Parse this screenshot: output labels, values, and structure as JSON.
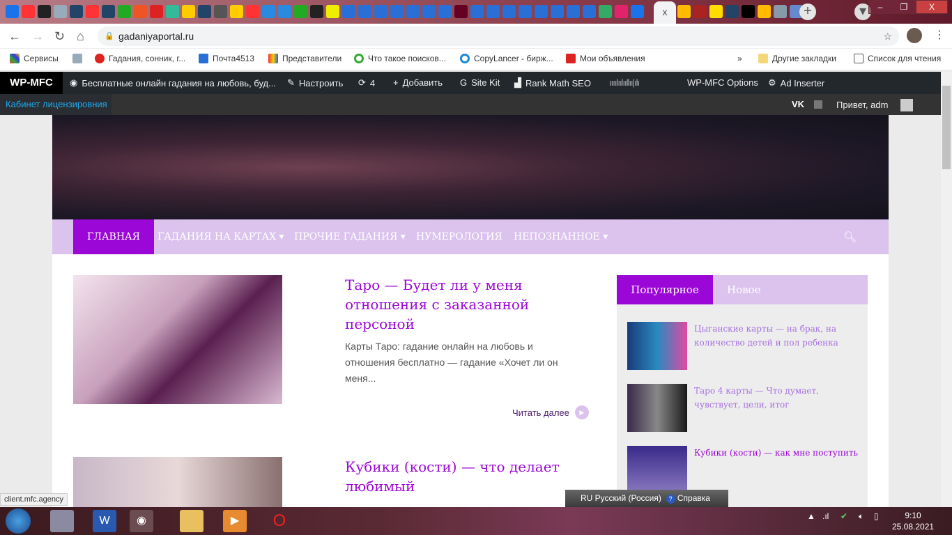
{
  "browser": {
    "url": "gadaniyaportal.ru",
    "active_tab_close": "x",
    "new_tab": "+",
    "bookmarks": [
      "Сервисы",
      "Гадания, сонник, г...",
      "Почта4513",
      "Представители",
      "Что такое поисков...",
      "CopyLancer - бирж...",
      "Мои объявления"
    ],
    "bookmarks_more": "»",
    "other_bookmarks": "Другие закладки",
    "reading_list": "Список для чтения"
  },
  "adminbar": {
    "logo": "WP-MFC",
    "site": "Бесплатные онлайн гадания на любовь, буд...",
    "customize": "Настроить",
    "updates": "4",
    "add": "Добавить",
    "sitekit": "Site Kit",
    "rankmath": "Rank Math SEO",
    "options": "WP-MFC Options",
    "adinserter": "Ad Inserter",
    "licence": "Кабинет лицензировния",
    "hello": "Привет, adm"
  },
  "nav": {
    "items": [
      "ГЛАВНАЯ",
      "ГАДАНИЯ НА КАРТАХ ▾",
      "ПРОЧИЕ ГАДАНИЯ ▾",
      "НУМЕРОЛОГИЯ",
      "НЕПОЗНАННОЕ ▾"
    ]
  },
  "posts": [
    {
      "title": "Таро — Будет ли у меня отношения с заказанной персоной",
      "excerpt": "Карты Таро: гадание онлайн на любовь и отношения бесплатно — гадание «Хочет ли он меня...",
      "more": "Читать далее"
    },
    {
      "title": "Кубики (кости) — что делает любимый"
    }
  ],
  "sidebar": {
    "tabs": [
      "Популярное",
      "Новое"
    ],
    "items": [
      "Цыганские карты — на брак, на количество детей и пол ребенка",
      "Таро 4 карты — Что думает, чувствует, цели, итог",
      "Кубики (кости) — как мне поступить"
    ]
  },
  "status_url": "client.mfc.agency",
  "langbar": {
    "lang": "RU Русский (Россия)",
    "help": "Справка"
  },
  "clock": {
    "time": "9:10",
    "date": "25.08.2021"
  },
  "colors": {
    "accent": "#9b07d6",
    "nav_bg": "#dbc3ed",
    "adminbar": "#23282d"
  }
}
